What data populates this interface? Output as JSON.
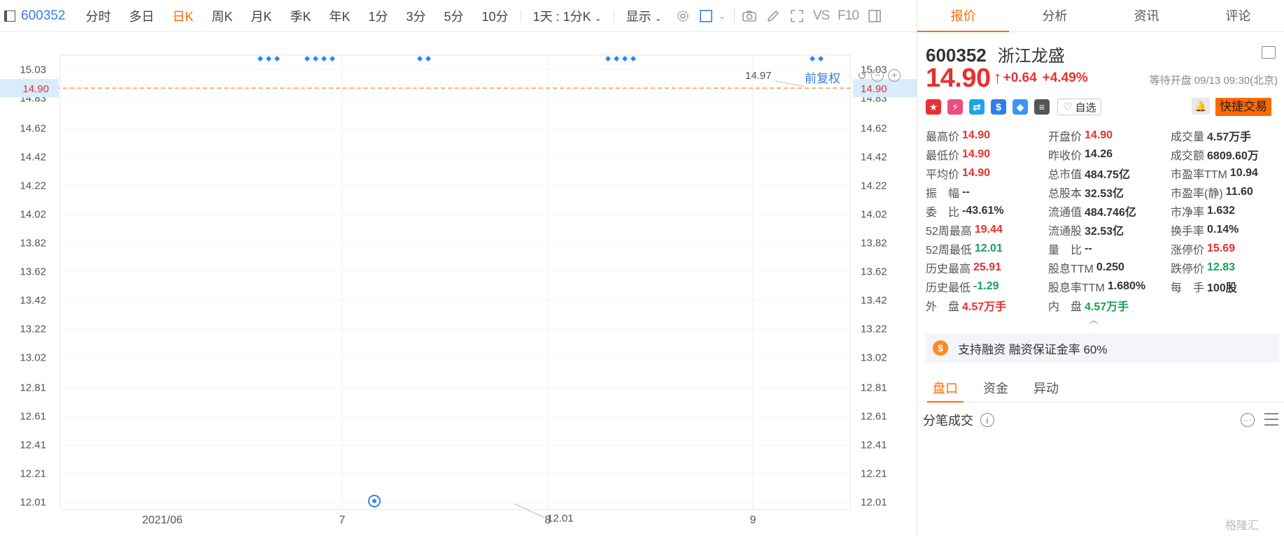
{
  "toolbar": {
    "code": "600352",
    "periods": [
      "分时",
      "多日",
      "日K",
      "周K",
      "月K",
      "季K",
      "年K",
      "1分",
      "3分",
      "5分",
      "10分"
    ],
    "active_period": "日K",
    "interval_select": "1天 : 1分K",
    "display_label": "显示",
    "vs_label": "VS",
    "f10_label": "F10"
  },
  "chart": {
    "restore_label": "前复权",
    "price_tag_left": "14.90",
    "price_tag_right": "14.90",
    "high_marker": "14.97",
    "low_marker": "12.01",
    "accent_up": "#e93030",
    "accent_down": "#0a9d47",
    "dashed_line_color": "#ff9a4a"
  },
  "chart_data": {
    "type": "candlestick",
    "y_ticks": [
      "15.03",
      "14.83",
      "14.62",
      "14.42",
      "14.22",
      "14.02",
      "13.82",
      "13.62",
      "13.42",
      "13.22",
      "13.02",
      "12.81",
      "12.61",
      "12.41",
      "12.21",
      "12.01"
    ],
    "x_labels": [
      "2021/06",
      "7",
      "8",
      "9"
    ],
    "ylim": [
      11.96,
      15.13
    ],
    "current_price": 14.9,
    "high_annotation": 14.97,
    "low_annotation": 12.01
  },
  "panel": {
    "tabs": [
      "报价",
      "分析",
      "资讯",
      "评论"
    ],
    "active_tab": "报价",
    "code": "600352",
    "name": "浙江龙盛",
    "price": "14.90",
    "change": "+0.64",
    "change_pct": "+4.49%",
    "status": "等待开盘 09/13 09:30(北京)",
    "watch_label": "自选",
    "quick_trade_label": "快捷交易",
    "badges": [
      {
        "icon": "china-flag-icon",
        "color": "#e93030"
      },
      {
        "icon": "lightning-icon",
        "color": "#ec4d7c"
      },
      {
        "icon": "shuffle-icon",
        "color": "#1aa7e8"
      },
      {
        "icon": "dollar-icon",
        "color": "#2f7ee8"
      },
      {
        "icon": "tag-icon",
        "color": "#3a96f0"
      },
      {
        "icon": "document-icon",
        "color": "#555555"
      }
    ],
    "stats": [
      {
        "label": "最高价",
        "value": "14.90",
        "tone": "up"
      },
      {
        "label": "开盘价",
        "value": "14.90",
        "tone": "up"
      },
      {
        "label": "成交量",
        "value": "4.57万手",
        "tone": ""
      },
      {
        "label": "最低价",
        "value": "14.90",
        "tone": "up"
      },
      {
        "label": "昨收价",
        "value": "14.26",
        "tone": ""
      },
      {
        "label": "成交额",
        "value": "6809.60万",
        "tone": ""
      },
      {
        "label": "平均价",
        "value": "14.90",
        "tone": "up"
      },
      {
        "label": "总市值",
        "value": "484.75亿",
        "tone": ""
      },
      {
        "label": "市盈率TTM",
        "value": "10.94",
        "tone": ""
      },
      {
        "label": "振　幅",
        "value": "--",
        "tone": ""
      },
      {
        "label": "总股本",
        "value": "32.53亿",
        "tone": ""
      },
      {
        "label": "市盈率(静)",
        "value": "11.60",
        "tone": ""
      },
      {
        "label": "委　比",
        "value": "-43.61%",
        "tone": ""
      },
      {
        "label": "流通值",
        "value": "484.746亿",
        "tone": ""
      },
      {
        "label": "市净率",
        "value": "1.632",
        "tone": ""
      },
      {
        "label": "52周最高",
        "value": "19.44",
        "tone": "up"
      },
      {
        "label": "流通股",
        "value": "32.53亿",
        "tone": ""
      },
      {
        "label": "换手率",
        "value": "0.14%",
        "tone": ""
      },
      {
        "label": "52周最低",
        "value": "12.01",
        "tone": "down"
      },
      {
        "label": "量　比",
        "value": "--",
        "tone": ""
      },
      {
        "label": "涨停价",
        "value": "15.69",
        "tone": "up"
      },
      {
        "label": "历史最高",
        "value": "25.91",
        "tone": "up"
      },
      {
        "label": "股息TTM",
        "value": "0.250",
        "tone": ""
      },
      {
        "label": "跌停价",
        "value": "12.83",
        "tone": "down"
      },
      {
        "label": "历史最低",
        "value": "-1.29",
        "tone": "down"
      },
      {
        "label": "股息率TTM",
        "value": "1.680%",
        "tone": ""
      },
      {
        "label": "每　手",
        "value": "100股",
        "tone": ""
      },
      {
        "label": "外　盘",
        "value": "4.57万手",
        "tone": "up"
      },
      {
        "label": "内　盘",
        "value": "4.57万手",
        "tone": "down"
      },
      {
        "label": "",
        "value": "",
        "tone": ""
      }
    ],
    "margin_text": "支持融资 融资保证金率 60%",
    "sub_tabs": [
      "盘口",
      "资金",
      "异动"
    ],
    "active_sub_tab": "盘口",
    "ticks_title": "分笔成交",
    "watermark": "格隆汇"
  }
}
